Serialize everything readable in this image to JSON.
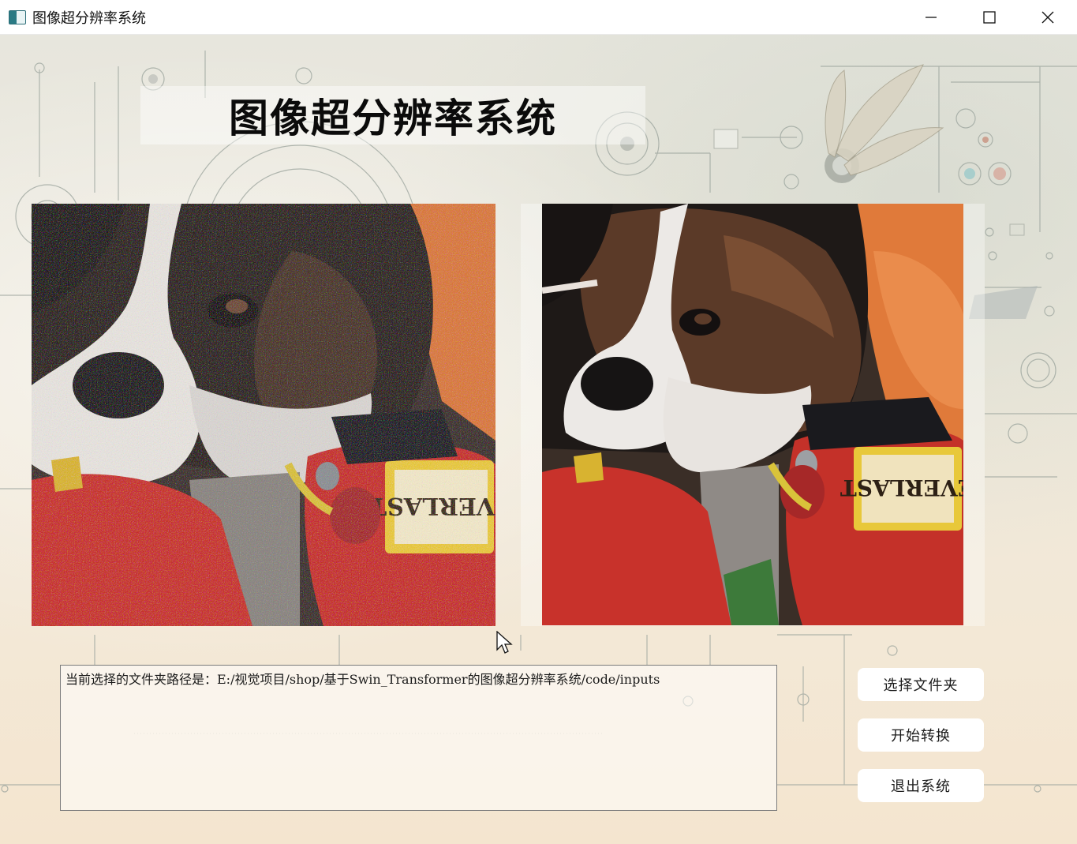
{
  "window": {
    "title": "图像超分辨率系统"
  },
  "header": {
    "title": "图像超分辨率系统"
  },
  "images": {
    "left": {
      "label": "low-resolution-noisy-dog-photo"
    },
    "right": {
      "label": "super-resolved-dog-photo"
    },
    "badge_text": "EVERLAST"
  },
  "path_box": {
    "text": "当前选择的文件夹路径是：E:/视觉项目/shop/基于Swin_Transformer的图像超分辨率系统/code/inputs"
  },
  "buttons": {
    "select_folder": "选择文件夹",
    "start_convert": "开始转换",
    "exit_system": "退出系统"
  },
  "icons": {
    "app": "app-window-icon",
    "minimize": "minimize-icon",
    "maximize": "maximize-icon",
    "close": "close-icon"
  },
  "colors": {
    "glove_red": "#c8322b",
    "badge_yellow": "#e8c83a",
    "fur_dark": "#2a211c",
    "background_orange": "#e07a3a"
  }
}
